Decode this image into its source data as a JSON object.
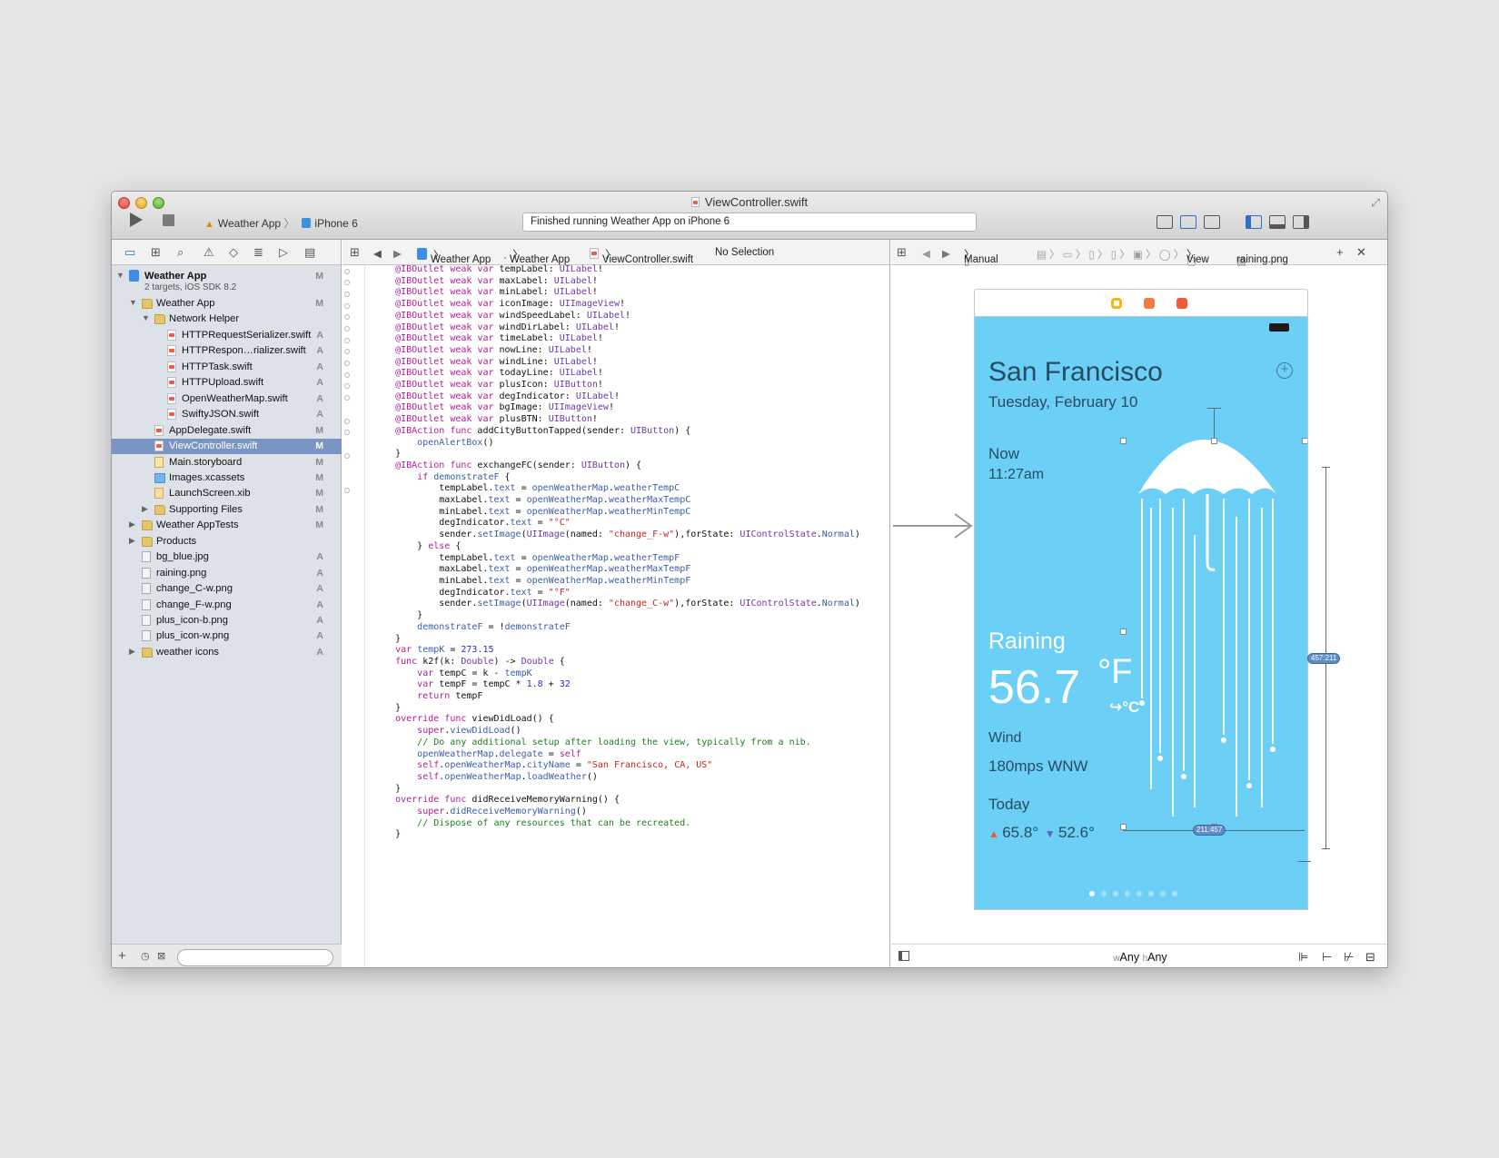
{
  "window": {
    "title": "ViewController.swift",
    "scheme": "Weather App",
    "device": "iPhone 6",
    "status": "Finished running Weather App on iPhone 6"
  },
  "editor_jump": [
    "Weather App",
    "Weather App",
    "ViewController.swift",
    "No Selection"
  ],
  "ib_jump": {
    "mode": "Manual",
    "view": "View",
    "file": "raining.png"
  },
  "navigator": {
    "project": {
      "name": "Weather App",
      "sub": "2 targets, iOS SDK 8.2",
      "status": "M"
    },
    "rows": [
      {
        "label": "Weather App",
        "status": "M",
        "indent": 1,
        "icon": "folder",
        "arrow": "open"
      },
      {
        "label": "Network Helper",
        "status": "",
        "indent": 2,
        "icon": "folder",
        "arrow": "open"
      },
      {
        "label": "HTTPRequestSerializer.swift",
        "status": "A",
        "indent": 3,
        "icon": "swift",
        "arrow": ""
      },
      {
        "label": "HTTPRespon…rializer.swift",
        "status": "A",
        "indent": 3,
        "icon": "swift",
        "arrow": ""
      },
      {
        "label": "HTTPTask.swift",
        "status": "A",
        "indent": 3,
        "icon": "swift",
        "arrow": ""
      },
      {
        "label": "HTTPUpload.swift",
        "status": "A",
        "indent": 3,
        "icon": "swift",
        "arrow": ""
      },
      {
        "label": "OpenWeatherMap.swift",
        "status": "A",
        "indent": 3,
        "icon": "swift",
        "arrow": ""
      },
      {
        "label": "SwiftyJSON.swift",
        "status": "A",
        "indent": 3,
        "icon": "swift",
        "arrow": ""
      },
      {
        "label": "AppDelegate.swift",
        "status": "M",
        "indent": 2,
        "icon": "swift",
        "arrow": ""
      },
      {
        "label": "ViewController.swift",
        "status": "M",
        "indent": 2,
        "icon": "swift",
        "arrow": "",
        "selected": true
      },
      {
        "label": "Main.storyboard",
        "status": "M",
        "indent": 2,
        "icon": "story",
        "arrow": ""
      },
      {
        "label": "Images.xcassets",
        "status": "M",
        "indent": 2,
        "icon": "assets",
        "arrow": ""
      },
      {
        "label": "LaunchScreen.xib",
        "status": "M",
        "indent": 2,
        "icon": "xib",
        "arrow": ""
      },
      {
        "label": "Supporting Files",
        "status": "M",
        "indent": 2,
        "icon": "folder",
        "arrow": "closed"
      },
      {
        "label": "Weather AppTests",
        "status": "M",
        "indent": 1,
        "icon": "folder",
        "arrow": "closed"
      },
      {
        "label": "Products",
        "status": "",
        "indent": 1,
        "icon": "folder",
        "arrow": "closed"
      },
      {
        "label": "bg_blue.jpg",
        "status": "A",
        "indent": 1,
        "icon": "png",
        "arrow": ""
      },
      {
        "label": "raining.png",
        "status": "A",
        "indent": 1,
        "icon": "png",
        "arrow": ""
      },
      {
        "label": "change_C-w.png",
        "status": "A",
        "indent": 1,
        "icon": "png",
        "arrow": ""
      },
      {
        "label": "change_F-w.png",
        "status": "A",
        "indent": 1,
        "icon": "png",
        "arrow": ""
      },
      {
        "label": "plus_icon-b.png",
        "status": "A",
        "indent": 1,
        "icon": "png",
        "arrow": ""
      },
      {
        "label": "plus_icon-w.png",
        "status": "A",
        "indent": 1,
        "icon": "png",
        "arrow": ""
      },
      {
        "label": "weather icons",
        "status": "A",
        "indent": 1,
        "icon": "folder",
        "arrow": "closed"
      }
    ]
  },
  "code_lines": [
    "    @IBOutlet weak var tempLabel: UILabel!",
    "    @IBOutlet weak var maxLabel: UILabel!",
    "    @IBOutlet weak var minLabel: UILabel!",
    "    @IBOutlet weak var iconImage: UIImageView!",
    "    @IBOutlet weak var windSpeedLabel: UILabel!",
    "    @IBOutlet weak var windDirLabel: UILabel!",
    "    @IBOutlet weak var timeLabel: UILabel!",
    "    @IBOutlet weak var nowLine: UILabel!",
    "    @IBOutlet weak var windLine: UILabel!",
    "    @IBOutlet weak var todayLine: UILabel!",
    "    @IBOutlet weak var plusIcon: UIButton!",
    "    @IBOutlet weak var degIndicator: UILabel!",
    "",
    "    @IBOutlet weak var bgImage: UIImageView!",
    "    @IBOutlet weak var plusBTN: UIButton!",
    "",
    "    @IBAction func addCityButtonTapped(sender: UIButton) {",
    "        openAlertBox()",
    "    }",
    "    @IBAction func exchangeFC(sender: UIButton) {",
    "        if demonstrateF {",
    "            tempLabel.text = openWeatherMap.weatherTempC",
    "            maxLabel.text = openWeatherMap.weatherMaxTempC",
    "            minLabel.text = openWeatherMap.weatherMinTempC",
    "            degIndicator.text = \"°C\"",
    "            sender.setImage(UIImage(named: \"change_F-w\"),forState: UIControlState.Normal)",
    "        } else {",
    "            tempLabel.text = openWeatherMap.weatherTempF",
    "            maxLabel.text = openWeatherMap.weatherMaxTempF",
    "            minLabel.text = openWeatherMap.weatherMinTempF",
    "            degIndicator.text = \"°F\"",
    "            sender.setImage(UIImage(named: \"change_C-w\"),forState: UIControlState.Normal)",
    "        }",
    "        demonstrateF = !demonstrateF",
    "    }",
    "",
    "",
    "    var tempK = 273.15",
    "",
    "    func k2f(k: Double) -> Double {",
    "        var tempC = k - tempK",
    "        var tempF = tempC * 1.8 + 32",
    "        return tempF",
    "    }",
    "",
    "",
    "    override func viewDidLoad() {",
    "        super.viewDidLoad()",
    "        // Do any additional setup after loading the view, typically from a nib.",
    "",
    "        openWeatherMap.delegate = self",
    "",
    "        self.openWeatherMap.cityName = \"San Francisco, CA, US\"",
    "        self.openWeatherMap.loadWeather()",
    "    }",
    "",
    "    override func didReceiveMemoryWarning() {",
    "        super.didReceiveMemoryWarning()",
    "        // Dispose of any resources that can be recreated.",
    "    }"
  ],
  "phone": {
    "city": "San Francisco",
    "date": "Tuesday, February 10",
    "now_label": "Now",
    "time": "11:27am",
    "condition": "Raining",
    "temp": "56.7",
    "unit": "°F",
    "unit_switch": "↪°C",
    "wind_label": "Wind",
    "wind_value": "180mps  WNW",
    "today_label": "Today",
    "high": "65.8°",
    "low": "52.6°",
    "plus": "+",
    "badge_width": "211:457",
    "badge_height": "457:211"
  },
  "size_class": {
    "w_prefix": "w",
    "w": "Any",
    "h_prefix": "h",
    "h": "Any"
  },
  "colors": {
    "phone_bg": "#6ccff5",
    "selected_row": "#7a94c4"
  }
}
